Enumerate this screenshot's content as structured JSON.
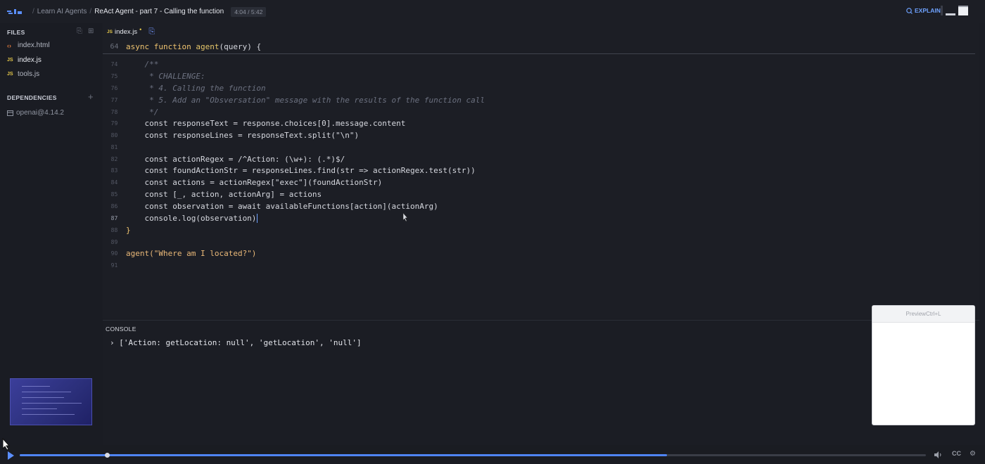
{
  "topbar": {
    "breadcrumbs": [
      "Learn AI Agents",
      "ReAct Agent - part 7 - Calling the function"
    ],
    "time": "4:04 / 5:42",
    "explain_label": "EXPLAIN",
    "icons": [
      "scrimba-logo-icon",
      "explain-icon",
      "layout-icon"
    ]
  },
  "sidebar": {
    "files_title": "FILES",
    "files": [
      {
        "name": "index.html",
        "icon": "html-file-icon"
      },
      {
        "name": "index.js",
        "icon": "js-file-icon",
        "active": true
      },
      {
        "name": "tools.js",
        "icon": "js-file-icon"
      }
    ],
    "dependencies_title": "DEPENDENCIES",
    "dependencies": [
      "openai@4.14.2"
    ]
  },
  "editor": {
    "tab_label": "index.js",
    "tab_modified": "•",
    "sticky": {
      "line_number": "64",
      "kw": "async function",
      "fn": "agent",
      "rest": "(query) {"
    },
    "lines": [
      {
        "n": "74",
        "text": "    /**"
      },
      {
        "n": "75",
        "text": "     * CHALLENGE:"
      },
      {
        "n": "76",
        "text": "     * 4. Calling the function"
      },
      {
        "n": "77",
        "text": "     * 5. Add an \"Obsversation\" message with the results of the function call"
      },
      {
        "n": "78",
        "text": "     */"
      },
      {
        "n": "79",
        "text": "    const responseText = response.choices[0].message.content"
      },
      {
        "n": "80",
        "text": "    const responseLines = responseText.split(\"\\n\")"
      },
      {
        "n": "81",
        "text": ""
      },
      {
        "n": "82",
        "text": "    const actionRegex = /^Action: (\\w+): (.*)$/"
      },
      {
        "n": "83",
        "text": "    const foundActionStr = responseLines.find(str => actionRegex.test(str))"
      },
      {
        "n": "84",
        "text": "    const actions = actionRegex[\"exec\"](foundActionStr)"
      },
      {
        "n": "85",
        "text": "    const [_, action, actionArg] = actions"
      },
      {
        "n": "86",
        "text": "    const observation = await availableFunctions[action](actionArg)"
      },
      {
        "n": "87",
        "text": "    console.log(observation)"
      },
      {
        "n": "88",
        "text": "}"
      },
      {
        "n": "89",
        "text": ""
      },
      {
        "n": "90",
        "text": "agent(\"Where am I located?\")"
      },
      {
        "n": "91",
        "text": ""
      }
    ]
  },
  "console": {
    "title": "CONSOLE",
    "output": "› ['Action: getLocation: null', 'getLocation', 'null']"
  },
  "preview": {
    "header": "PreviewCtrl+L"
  },
  "player": {
    "progress": 0.714,
    "scrub_position": 0.094,
    "controls": [
      "play-icon",
      "volume-icon",
      "captions-icon",
      "settings-icon"
    ],
    "cc_label": "CC"
  }
}
